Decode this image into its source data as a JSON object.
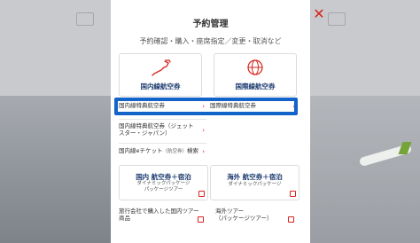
{
  "modal": {
    "title": "予約管理",
    "subtitle": "予約確認・購入・座席指定／変更・取消など",
    "close_icon": "close-icon"
  },
  "domestic": {
    "label": "国内線航空券",
    "icon": "japan-map-icon",
    "items": [
      {
        "label": "国内線特典航空券"
      },
      {
        "label": "国内線特典航空券（ジェットスター・ジャパン）"
      },
      {
        "label_main": "国内線eチケット",
        "label_small": "（航空券）",
        "label_tail": "検索"
      }
    ]
  },
  "international": {
    "label": "国際線航空券",
    "icon": "globe-icon",
    "items": [
      {
        "label": "国際線特典航空券"
      }
    ]
  },
  "packages": {
    "domestic": {
      "title": "国内 航空券＋宿泊",
      "sub1": "ダイナミックパッケージ",
      "sub2": "パッケージツアー"
    },
    "international": {
      "title": "海外 航空券＋宿泊",
      "sub1": "ダイナミックパッケージ"
    }
  },
  "bottom": {
    "left": {
      "line1": "旅行会社で購入した国内ツアー",
      "line2": "商品"
    },
    "right": {
      "line1": "海外ツアー",
      "line2": "（パッケージツアー）"
    }
  },
  "colors": {
    "accent": "#d7231d",
    "navy": "#1b3a6e",
    "highlight": "#1264c8"
  }
}
